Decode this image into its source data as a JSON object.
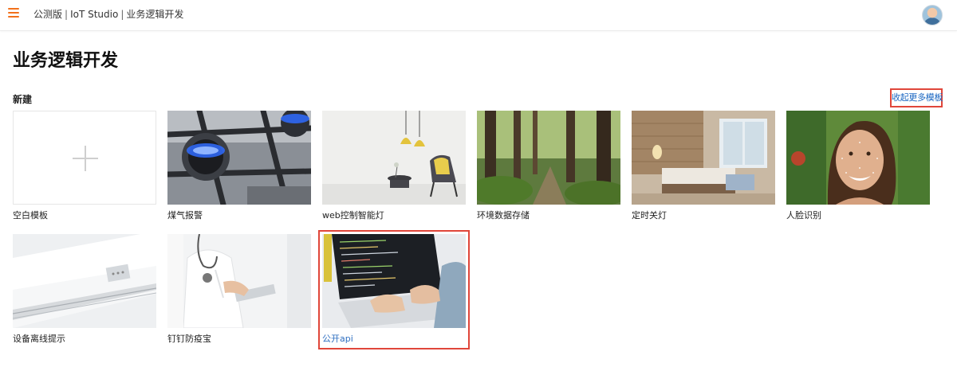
{
  "header": {
    "breadcrumb": [
      "公测版",
      "IoT Studio",
      "业务逻辑开发"
    ],
    "separator": "|",
    "menu_icon": "hamburger-icon",
    "avatar_icon": "user-avatar"
  },
  "page": {
    "title": "业务逻辑开发",
    "section_title": "新建",
    "collapse_link": "收起更多模板"
  },
  "templates": [
    {
      "label": "空白模板",
      "image": "plus-icon"
    },
    {
      "label": "煤气报警",
      "image": "gas-stove-photo"
    },
    {
      "label": "web控制智能灯",
      "image": "pendant-lamp-room-photo"
    },
    {
      "label": "环境数据存储",
      "image": "forest-photo"
    },
    {
      "label": "定时关灯",
      "image": "bedroom-photo"
    },
    {
      "label": "人脸识别",
      "image": "face-recognition-photo"
    },
    {
      "label": "设备离线提示",
      "image": "air-conditioner-photo"
    },
    {
      "label": "钉钉防疫宝",
      "image": "doctor-tablet-photo"
    },
    {
      "label": "公开api",
      "image": "laptop-code-photo"
    }
  ],
  "colors": {
    "accent": "#f2701a",
    "link": "#1a66c2",
    "highlight_border": "#e0463a"
  }
}
